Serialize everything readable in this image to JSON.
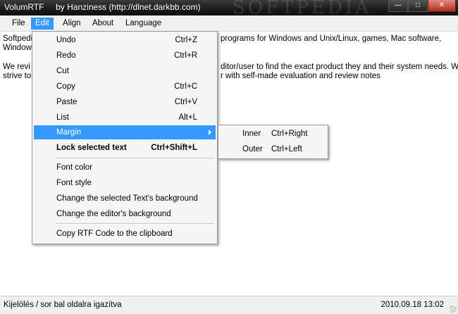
{
  "window": {
    "title": "VolumRTF     by Hanziness (http://dlnet.darkbb.com)"
  },
  "menubar": {
    "items": [
      "File",
      "Edit",
      "Align",
      "About",
      "Language"
    ]
  },
  "content": {
    "line1_left": "Softpedi",
    "line1_right": "programs for Windows and Unix/Linux, games, Mac software,",
    "line2_left": "Window",
    "line3_left": "We revi",
    "line3_right": "ditor/user to find the exact product they and their system needs. We",
    "line4_left": "strive to",
    "line4_right": "r with self-made evaluation and review notes"
  },
  "edit_menu": {
    "items": [
      {
        "label": "Undo",
        "shortcut": "Ctrl+Z"
      },
      {
        "label": "Redo",
        "shortcut": "Ctrl+R"
      },
      {
        "label": "Cut",
        "shortcut": ""
      },
      {
        "label": "Copy",
        "shortcut": "Ctrl+C"
      },
      {
        "label": "Paste",
        "shortcut": "Ctrl+V"
      },
      {
        "label": "List",
        "shortcut": "Alt+L"
      },
      {
        "label": "Margin",
        "shortcut": ""
      },
      {
        "label": "Lock selected text",
        "shortcut": "Ctrl+Shift+L"
      },
      {
        "label": "Font color",
        "shortcut": ""
      },
      {
        "label": "Font style",
        "shortcut": ""
      },
      {
        "label": "Change the selected Text's background",
        "shortcut": ""
      },
      {
        "label": "Change the editor's background",
        "shortcut": ""
      },
      {
        "label": "Copy RTF Code to the clipboard",
        "shortcut": ""
      }
    ]
  },
  "margin_submenu": {
    "items": [
      {
        "label": "Inner",
        "shortcut": "Ctrl+Right"
      },
      {
        "label": "Outer",
        "shortcut": "Ctrl+Left"
      }
    ]
  },
  "statusbar": {
    "left": "Kijelölés / sor bal oldalra igazítva",
    "right": "2010.09.18 13:02"
  },
  "watermark": "SOFTPEDIA",
  "colors": {
    "highlight": "#3399ff",
    "titlebar": "#1a1a1a",
    "menubar": "#f0f0f0"
  }
}
